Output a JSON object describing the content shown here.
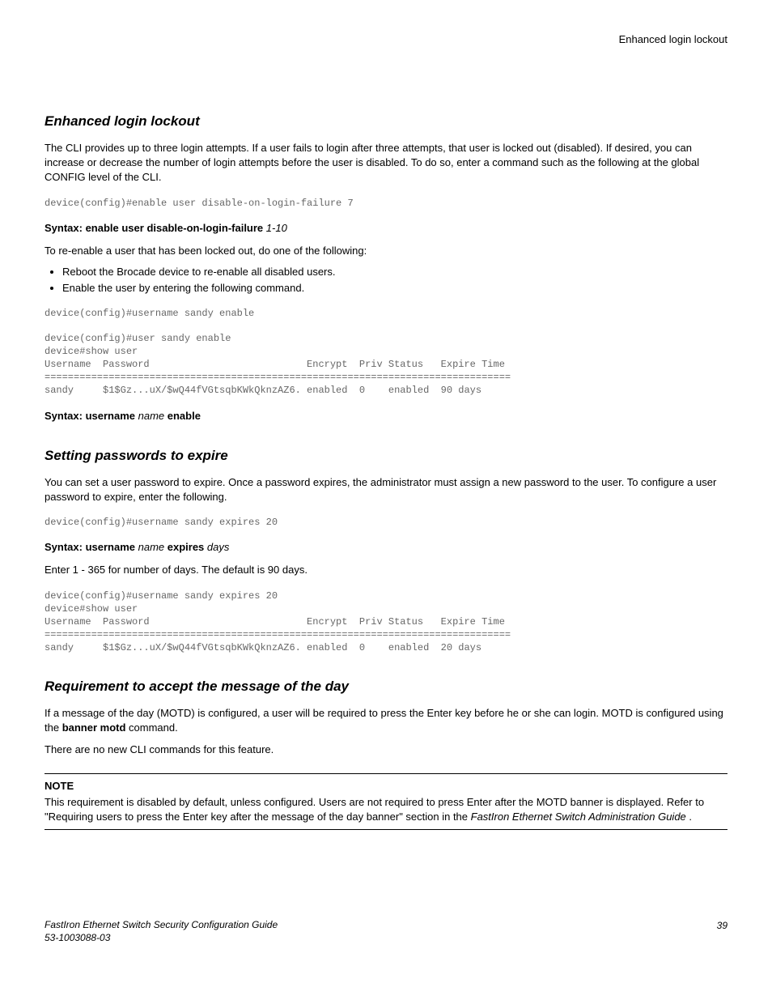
{
  "header": {
    "title": "Enhanced login lockout"
  },
  "section1": {
    "heading": "Enhanced login lockout",
    "para1": "The CLI provides up to three login attempts. If a user fails to login after three attempts, that user is locked out (disabled). If desired, you can increase or decrease the number of login attempts before the user is disabled. To do so, enter a command such as the following at the global CONFIG level of the CLI.",
    "code1": "device(config)#enable user disable-on-login-failure 7",
    "syntax1_bold": "Syntax: enable user disable-on-login-failure",
    "syntax1_italic": " 1-10",
    "para2": "To re-enable a user that has been locked out, do one of the following:",
    "bullet1": "Reboot the Brocade device to re-enable all disabled users.",
    "bullet2": "Enable the user by entering the following command.",
    "code2": "device(config)#username sandy enable",
    "code3": "device(config)#user sandy enable\ndevice#show user\nUsername  Password                           Encrypt  Priv Status   Expire Time\n================================================================================\nsandy     $1$Gz...uX/$wQ44fVGtsqbKWkQknzAZ6. enabled  0    enabled  90 days",
    "syntax2_bold1": "Syntax: username",
    "syntax2_italic": " name",
    "syntax2_bold2": " enable"
  },
  "section2": {
    "heading": "Setting passwords to expire",
    "para1": "You can set a user password to expire. Once a password expires, the administrator must assign a new password to the user. To configure a user password to expire, enter the following.",
    "code1": "device(config)#username sandy expires 20",
    "syntax1_bold1": "Syntax: username",
    "syntax1_italic1": " name",
    "syntax1_bold2": " expires",
    "syntax1_italic2": " days",
    "para2": "Enter 1 - 365 for number of days. The default is 90 days.",
    "code2": "device(config)#username sandy expires 20\ndevice#show user\nUsername  Password                           Encrypt  Priv Status   Expire Time\n================================================================================\nsandy     $1$Gz...uX/$wQ44fVGtsqbKWkQknzAZ6. enabled  0    enabled  20 days"
  },
  "section3": {
    "heading": "Requirement to accept the message of the day",
    "para1_a": "If a message of the day (MOTD) is configured, a user will be required to press the Enter key before he or she can login. MOTD is configured using the ",
    "para1_bold": "banner motd",
    "para1_b": " command.",
    "para2": "There are no new CLI commands for this feature.",
    "note_label": "NOTE",
    "note_a": "This requirement is disabled by default, unless configured. Users are not required to press Enter after the MOTD banner is displayed. Refer to \"Requiring users to press the Enter key after the message of the day banner\" section in the ",
    "note_italic": "FastIron Ethernet Switch Administration Guide",
    "note_b": " ."
  },
  "footer": {
    "line1": "FastIron Ethernet Switch Security Configuration Guide",
    "line2": "53-1003088-03",
    "page": "39"
  }
}
